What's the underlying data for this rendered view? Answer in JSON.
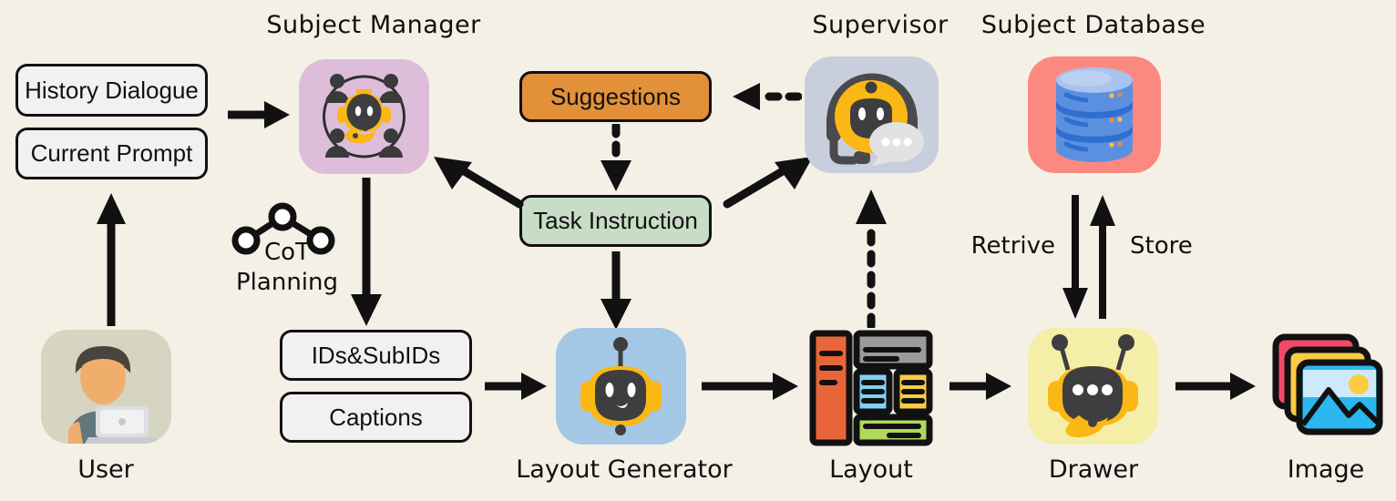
{
  "diagram": {
    "background_color": "#F4F0E6",
    "titles": {
      "subject_manager": "Subject Manager",
      "supervisor": "Supervisor",
      "subject_database": "Subject Database"
    },
    "captions": {
      "user": "User",
      "layout_generator": "Layout Generator",
      "layout": "Layout",
      "drawer": "Drawer",
      "image": "Image"
    },
    "boxes": {
      "history_dialogue": "History Dialogue",
      "current_prompt": "Current Prompt",
      "suggestions": "Suggestions",
      "task_instruction": "Task Instruction",
      "ids_subids": "IDs&SubIDs",
      "captions_box": "Captions"
    },
    "edge_labels": {
      "cot_planning_line1": "CoT",
      "cot_planning_line2": "Planning",
      "retrieve": "Retrive",
      "store": "Store"
    },
    "colors": {
      "subject_manager_tile": "#DEBDDA",
      "supervisor_tile": "#C8CEDC",
      "subject_database_tile": "#FC8980",
      "user_tile": "#D6D5C1",
      "layout_generator_tile": "#A5C7E6",
      "drawer_tile": "#F4EEA8",
      "suggestions_box": "#E2913A",
      "task_instruction_box": "#C9DCC6",
      "plain_box": "#F1F1F1",
      "stroke": "#111111",
      "bot_yellow": "#FBB713",
      "bot_dark": "#3E3E40"
    }
  }
}
